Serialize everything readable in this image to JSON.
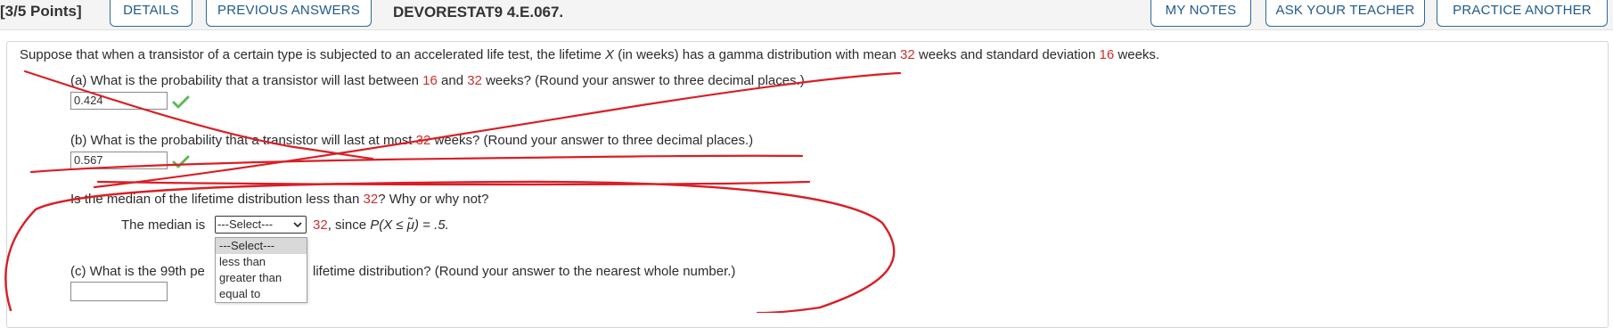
{
  "header": {
    "points": "[3/5 Points]",
    "details": "DETAILS",
    "previous_answers": "PREVIOUS ANSWERS",
    "question_id": "DEVORESTAT9 4.E.067.",
    "my_notes": "MY NOTES",
    "ask_teacher": "ASK YOUR TEACHER",
    "practice_another": "PRACTICE ANOTHER"
  },
  "intro": {
    "pre": "Suppose that when a transistor of a certain type is subjected to an accelerated life test, the lifetime ",
    "var": "X",
    "mid1": " (in weeks) has a gamma distribution with mean ",
    "mean": "32",
    "mid2": " weeks and standard deviation ",
    "sd": "16",
    "post": " weeks."
  },
  "part_a": {
    "pre": "(a) What is the probability that a transistor will last between ",
    "v1": "16",
    "mid": " and ",
    "v2": "32",
    "post": " weeks? (Round your answer to three decimal places.)",
    "answer": "0.424"
  },
  "part_b": {
    "pre": "(b) What is the probability that a transistor will last at most ",
    "v1": "32",
    "post": " weeks? (Round your answer to three decimal places.)",
    "answer": "0.567"
  },
  "median_q": {
    "pre": "Is the median of the lifetime distribution less than ",
    "v1": "32",
    "post": "? Why or why not?",
    "label": "The median is",
    "select_value": "---Select---",
    "after_value": "32",
    "after_text_1": ", since ",
    "after_text_2": "P(X ≤ μ̃) = .5.",
    "options": [
      "---Select---",
      "less than",
      "greater than",
      "equal to"
    ]
  },
  "part_c": {
    "pre": "(c) What is the 99th pe",
    "post": " lifetime distribution? (Round your answer to the nearest whole number.)",
    "answer": ""
  },
  "colors": {
    "accent": "#1f5a8c",
    "highlight": "#c9302c",
    "ink": "#d81f26",
    "check": "#5cb85c"
  }
}
